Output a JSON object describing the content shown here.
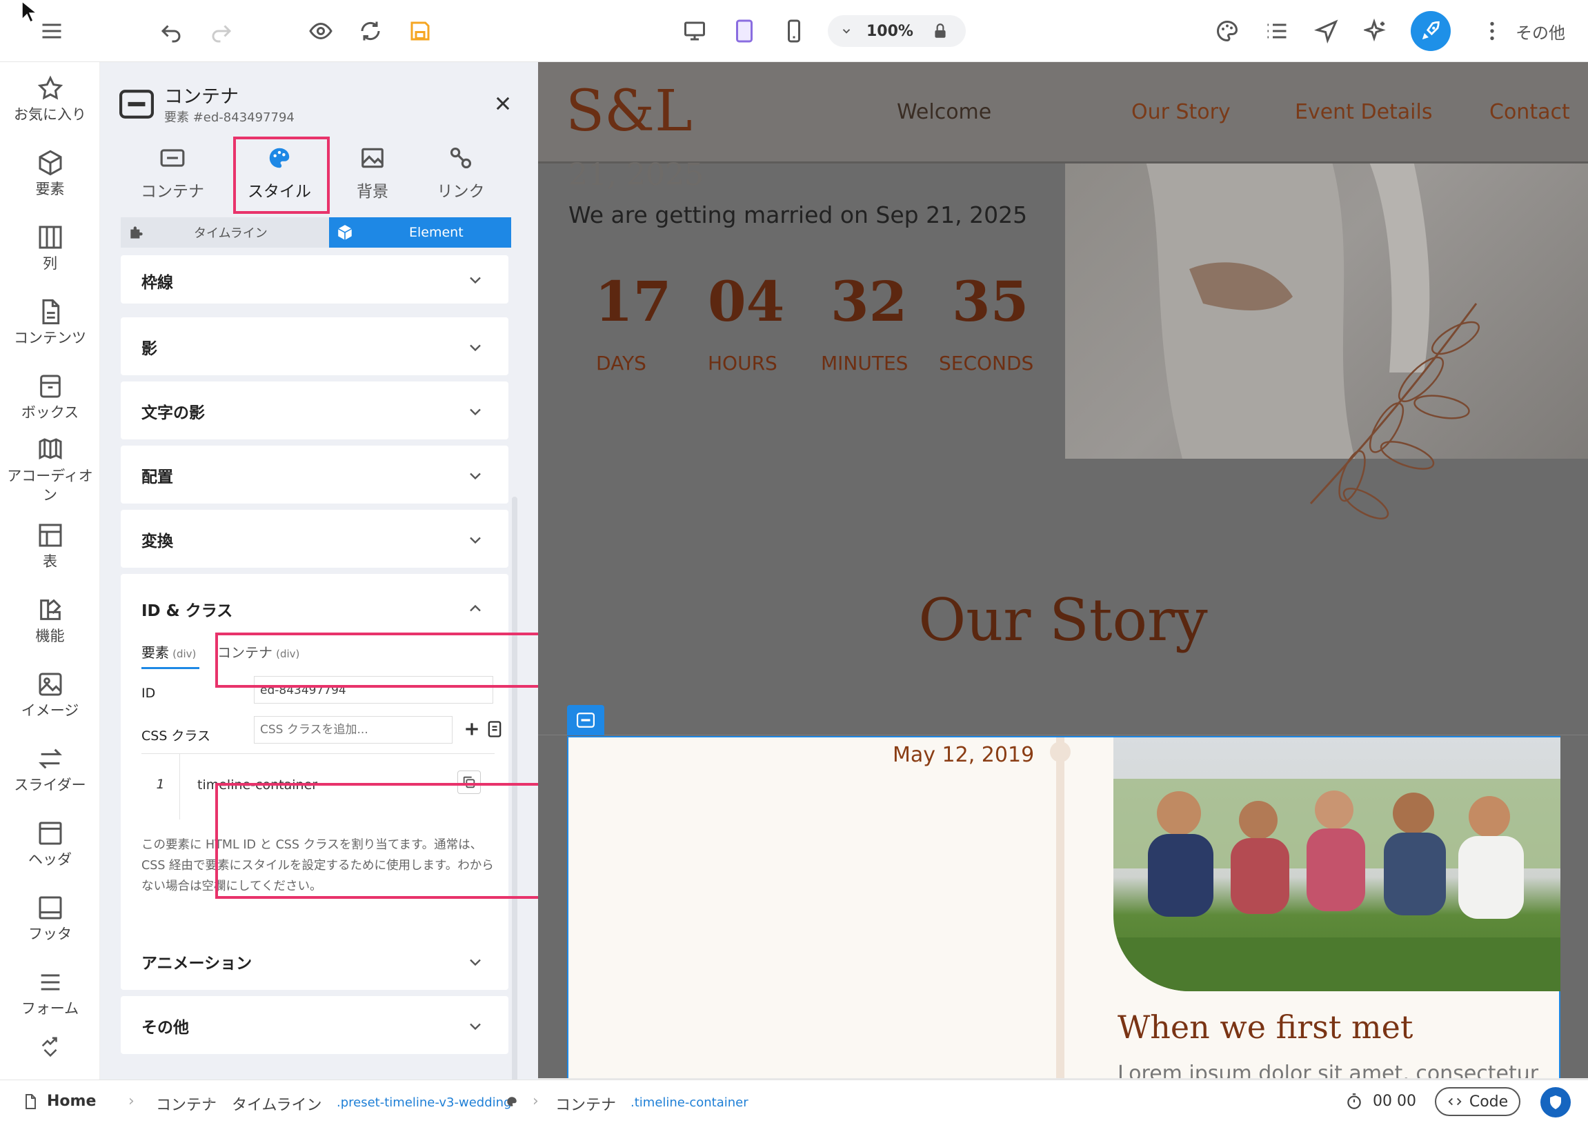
{
  "topbar": {
    "zoom": "100%",
    "more_label": "その他",
    "colors": {
      "accent": "#1e90e8",
      "save": "#f5a623",
      "tablet_active": "#8a6de0"
    }
  },
  "rail": {
    "items": [
      {
        "label": "お気に入り",
        "icon": "star-icon"
      },
      {
        "label": "要素",
        "icon": "cube-icon"
      },
      {
        "label": "列",
        "icon": "columns-icon"
      },
      {
        "label": "コンテンツ",
        "icon": "document-icon"
      },
      {
        "label": "ボックス",
        "icon": "box-icon"
      },
      {
        "label": "アコーディオン",
        "icon": "accordion-icon"
      },
      {
        "label": "表",
        "icon": "table-icon"
      },
      {
        "label": "機能",
        "icon": "features-icon"
      },
      {
        "label": "イメージ",
        "icon": "image-icon"
      },
      {
        "label": "スライダー",
        "icon": "slider-icon"
      },
      {
        "label": "ヘッダ",
        "icon": "header-icon"
      },
      {
        "label": "フッタ",
        "icon": "footer-icon"
      },
      {
        "label": "フォーム",
        "icon": "form-icon"
      }
    ]
  },
  "panel": {
    "title": "コンテナ",
    "subtitle": "要素 #ed-843497794",
    "tabs": [
      {
        "label": "コンテナ"
      },
      {
        "label": "スタイル"
      },
      {
        "label": "背景"
      },
      {
        "label": "リンク"
      }
    ],
    "segment": {
      "left": "タイムライン",
      "right": "Element"
    },
    "sections": {
      "border": "枠線",
      "shadow": "影",
      "text_shadow": "文字の影",
      "align": "配置",
      "transform": "変換",
      "id_class": "ID & クラス",
      "animation": "アニメーション",
      "other": "その他"
    },
    "id_class": {
      "subtab_element": "要素",
      "subtab_element_tag": "(div)",
      "subtab_container": "コンテナ",
      "subtab_container_tag": "(div)",
      "id_label": "ID",
      "id_value": "ed-843497794",
      "css_label": "CSS クラス",
      "css_placeholder": "CSS クラスを追加...",
      "class_index": "1",
      "class_name": "timeline-container",
      "help": "この要素に HTML ID と CSS クラスを割り当てます。通常は、CSS 経由で要素にスタイルを設定するために使用します。わからない場合は空欄にしてください。"
    }
  },
  "canvas": {
    "brand": "S&L",
    "nav": [
      "Welcome",
      "Our Story",
      "Event Details",
      "Contact"
    ],
    "date_fragment": "21, 2025",
    "married_text": "We are getting married on Sep 21, 2025",
    "countdown": [
      {
        "value": "17",
        "label": "DAYS"
      },
      {
        "value": "04",
        "label": "HOURS"
      },
      {
        "value": "32",
        "label": "MINUTES"
      },
      {
        "value": "35",
        "label": "SECONDS"
      }
    ],
    "section_title": "Our Story",
    "timeline_date": "May 12, 2019",
    "timeline_heading": "When we first met",
    "timeline_body_fragment": "Lorem ipsum dolor sit amet, consectetur"
  },
  "bottombar": {
    "breadcrumbs": [
      "Home",
      "コンテナ",
      "タイムライン",
      ".preset-timeline-v3-wedding",
      "コンテナ",
      ".timeline-container"
    ],
    "timer": "00 00",
    "code_label": "Code"
  }
}
